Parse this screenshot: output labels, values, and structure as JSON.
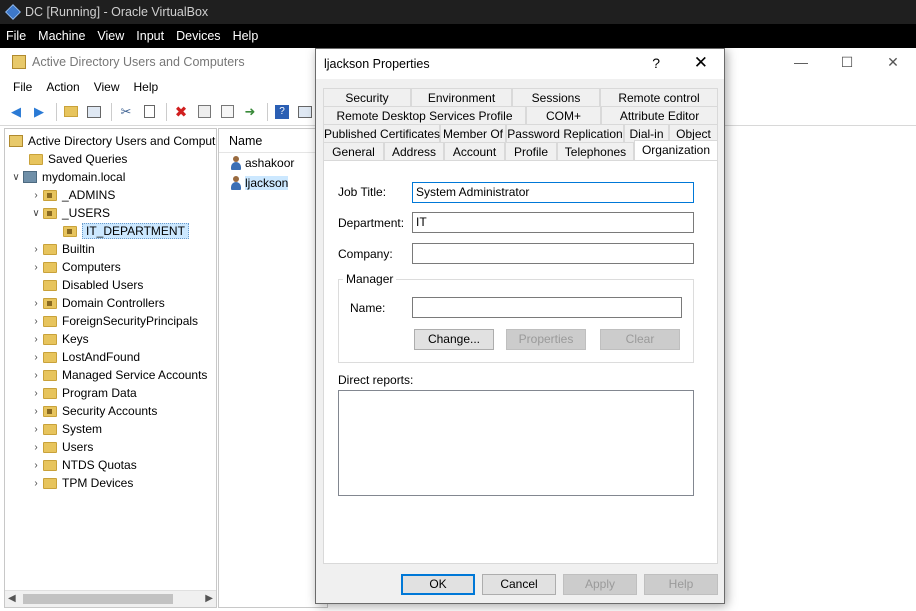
{
  "vbox": {
    "title": "DC [Running] - Oracle VirtualBox",
    "menu": [
      "File",
      "Machine",
      "View",
      "Input",
      "Devices",
      "Help"
    ]
  },
  "aduc": {
    "title": "Active Directory Users and Computers",
    "menu": [
      "File",
      "Action",
      "View",
      "Help"
    ],
    "window_buttons": [
      "—",
      "☐",
      "✕"
    ],
    "toolbar_icons": [
      "back-arrow-icon",
      "forward-arrow-icon",
      "up-folder-icon",
      "show-tree-icon",
      "cut-icon",
      "copy-icon",
      "delete-icon",
      "properties-icon",
      "refresh-icon",
      "export-icon",
      "help-icon",
      "console-icon"
    ],
    "tree": {
      "root": "Active Directory Users and Comput",
      "items": [
        {
          "label": "Saved Queries"
        },
        {
          "label": "mydomain.local"
        },
        {
          "label": "_ADMINS"
        },
        {
          "label": "_USERS"
        },
        {
          "label": "IT_DEPARTMENT"
        },
        {
          "label": "Builtin"
        },
        {
          "label": "Computers"
        },
        {
          "label": "Disabled Users"
        },
        {
          "label": "Domain Controllers"
        },
        {
          "label": "ForeignSecurityPrincipals"
        },
        {
          "label": "Keys"
        },
        {
          "label": "LostAndFound"
        },
        {
          "label": "Managed Service Accounts"
        },
        {
          "label": "Program Data"
        },
        {
          "label": "Security Accounts"
        },
        {
          "label": "System"
        },
        {
          "label": "Users"
        },
        {
          "label": "NTDS Quotas"
        },
        {
          "label": "TPM Devices"
        }
      ]
    },
    "list": {
      "header": "Name",
      "rows": [
        "ashakoor",
        "ljackson"
      ]
    }
  },
  "dialog": {
    "title": "ljackson Properties",
    "help": "?",
    "close": "✕",
    "tabs_row1": [
      "Security",
      "Environment",
      "Sessions",
      "Remote control"
    ],
    "tabs_row2": [
      "Remote Desktop Services Profile",
      "COM+",
      "Attribute Editor"
    ],
    "tabs_row3": [
      "Published Certificates",
      "Member Of",
      "Password Replication",
      "Dial-in",
      "Object"
    ],
    "tabs_row4": [
      "General",
      "Address",
      "Account",
      "Profile",
      "Telephones",
      "Organization"
    ],
    "active_tab": "Organization",
    "fields": {
      "job_title_label": "Job Title:",
      "job_title_value": "System Administrator",
      "department_label": "Department:",
      "department_value": "IT",
      "company_label": "Company:",
      "company_value": "",
      "manager_group": "Manager",
      "manager_name_label": "Name:",
      "manager_name_value": "",
      "change_btn": "Change...",
      "properties_btn": "Properties",
      "clear_btn": "Clear",
      "direct_reports_label": "Direct reports:"
    },
    "buttons": {
      "ok": "OK",
      "cancel": "Cancel",
      "apply": "Apply",
      "help": "Help"
    }
  }
}
